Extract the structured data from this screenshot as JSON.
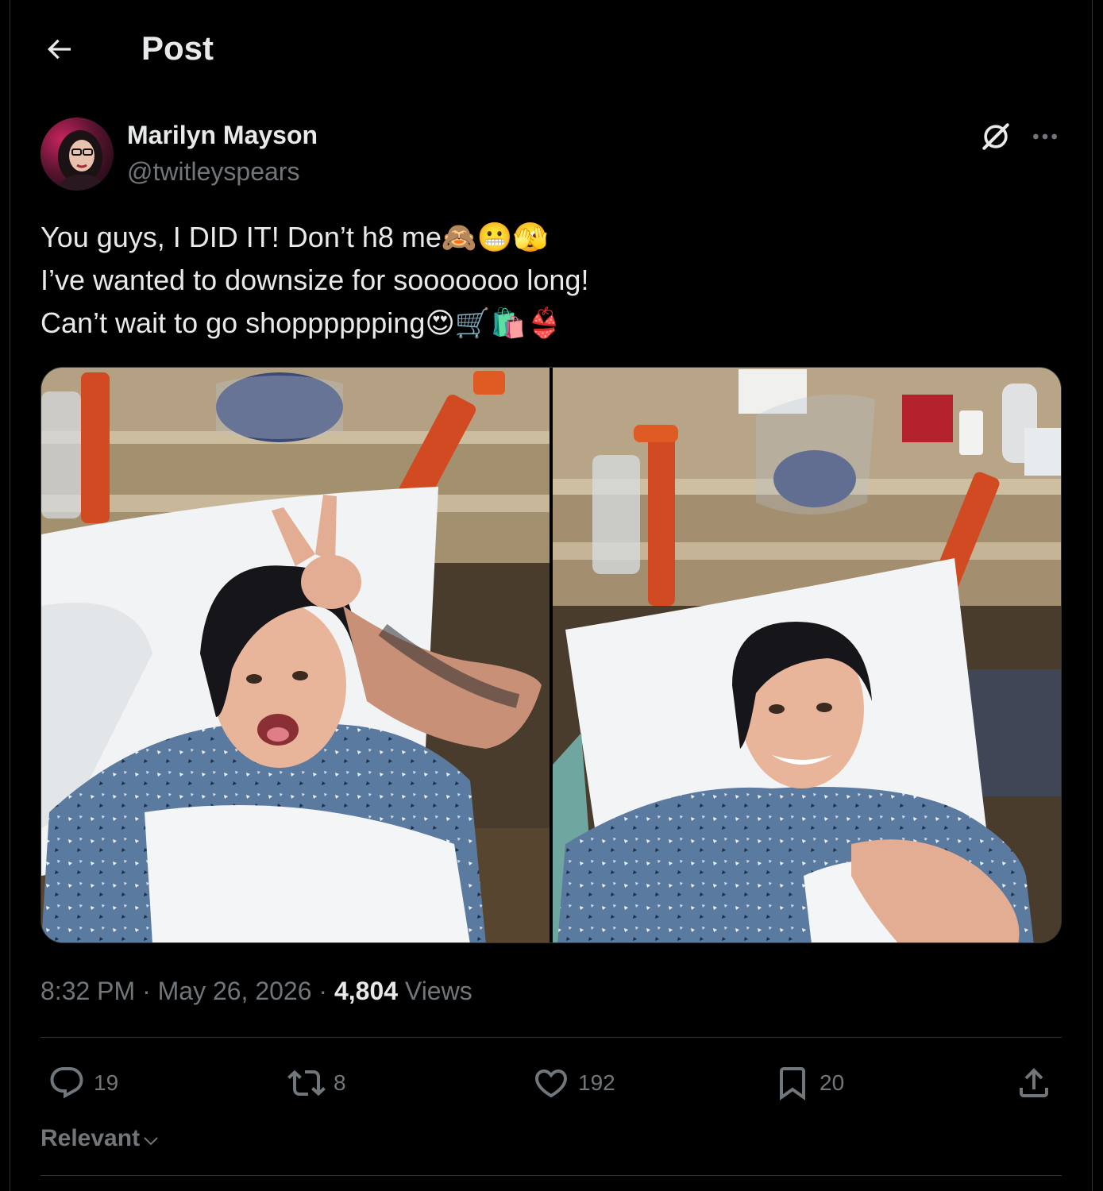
{
  "header": {
    "title": "Post",
    "back_icon": "arrow-left-icon"
  },
  "author": {
    "name": "Marilyn Mayson",
    "handle": "@twitleyspears",
    "avatar_icon": "avatar"
  },
  "post": {
    "lines": [
      "You guys, I DID IT! Don’t h8 me🙈😬🫣",
      "I’ve wanted to downsize for sooooooo long!",
      "Can’t wait to go shopppppping😍🛒🛍️👙"
    ],
    "time": "8:32 PM",
    "separator": "·",
    "date": "May 26, 2026",
    "views_count": "4,804",
    "views_label": "Views"
  },
  "actions": {
    "replies": "19",
    "reposts": "8",
    "likes": "192",
    "bookmarks": "20"
  },
  "sort": {
    "label": "Relevant"
  },
  "colors": {
    "background": "#000000",
    "text": "#e7e9ea",
    "muted": "#71767b",
    "border": "#2f3336"
  }
}
